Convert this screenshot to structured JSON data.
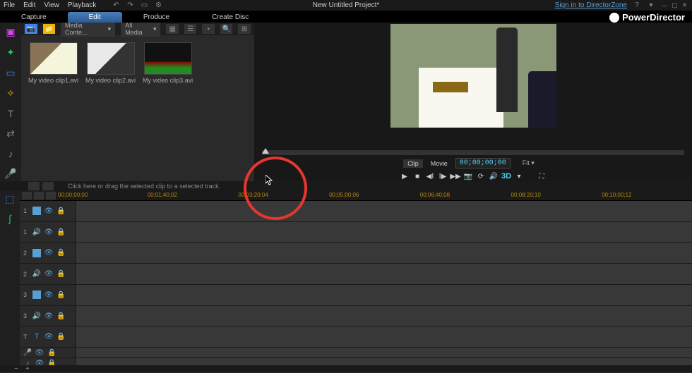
{
  "menu": {
    "file": "File",
    "edit": "Edit",
    "view": "View",
    "playback": "Playback"
  },
  "project_title": "New Untitled Project*",
  "signin": "Sign in to DirectorZone",
  "brand": "PowerDirector",
  "tabs": {
    "capture": "Capture",
    "edit": "Edit",
    "produce": "Produce",
    "create_disc": "Create Disc"
  },
  "media_toolbar": {
    "room_select": "Media Conte...",
    "filter": "All Media"
  },
  "media_items": [
    {
      "label": "My video clip1.avi"
    },
    {
      "label": "My video clip2.avi"
    },
    {
      "label": "My video clip3.avi"
    }
  ],
  "preview": {
    "tab_clip": "Clip",
    "tab_movie": "Movie",
    "timecode": "00;00;00;00",
    "fit": "Fit",
    "btn_3d": "3D"
  },
  "hint": "Click here or drag the selected clip to a selected track.",
  "timeline": {
    "ticks": [
      "00;00;00;00",
      "00;01;40;02",
      "00;03;20;04",
      "00;05;00;06",
      "00;06;40;08",
      "00;08;20;10",
      "00;10;00;12"
    ],
    "tracks": [
      {
        "num": "1",
        "type": "video"
      },
      {
        "num": "1",
        "type": "audio"
      },
      {
        "num": "2",
        "type": "video"
      },
      {
        "num": "2",
        "type": "audio"
      },
      {
        "num": "3",
        "type": "video"
      },
      {
        "num": "3",
        "type": "audio"
      },
      {
        "num": "",
        "type": "title",
        "label": "T"
      },
      {
        "num": "",
        "type": "voice"
      },
      {
        "num": "",
        "type": "music"
      }
    ]
  }
}
